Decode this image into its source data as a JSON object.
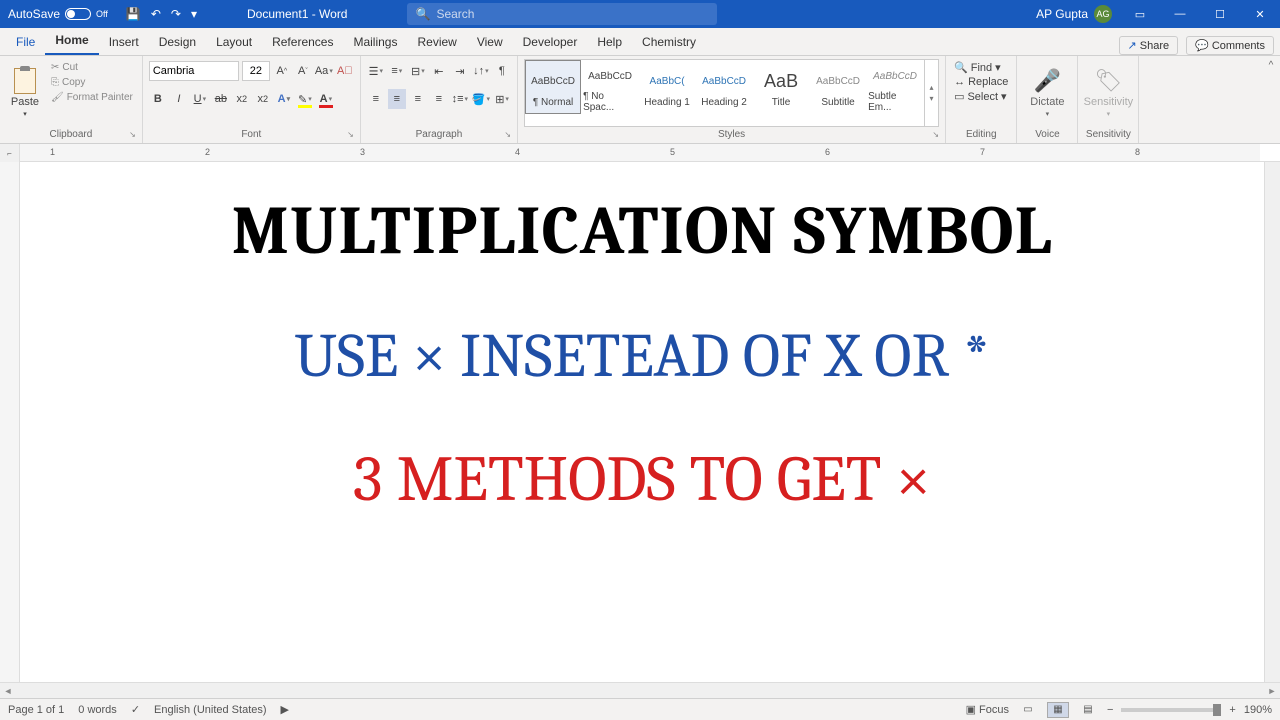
{
  "titlebar": {
    "autosave_label": "AutoSave",
    "autosave_state": "Off",
    "doc_title": "Document1 - Word",
    "search_placeholder": "Search",
    "user_name": "AP Gupta",
    "user_initials": "AG"
  },
  "tabs": {
    "items": [
      "File",
      "Home",
      "Insert",
      "Design",
      "Layout",
      "References",
      "Mailings",
      "Review",
      "View",
      "Developer",
      "Help",
      "Chemistry"
    ],
    "active": "Home",
    "share": "Share",
    "comments": "Comments"
  },
  "ribbon": {
    "clipboard": {
      "label": "Clipboard",
      "paste": "Paste",
      "cut": "Cut",
      "copy": "Copy",
      "format_painter": "Format Painter"
    },
    "font": {
      "label": "Font",
      "name": "Cambria",
      "size": "22"
    },
    "paragraph": {
      "label": "Paragraph"
    },
    "styles": {
      "label": "Styles",
      "items": [
        {
          "preview": "AaBbCcD",
          "name": "¶ Normal",
          "sel": true
        },
        {
          "preview": "AaBbCcD",
          "name": "¶ No Spac...",
          "sel": false
        },
        {
          "preview": "AaBbC(",
          "name": "Heading 1",
          "sel": false,
          "color": "#2e74b5"
        },
        {
          "preview": "AaBbCcD",
          "name": "Heading 2",
          "sel": false,
          "color": "#2e74b5"
        },
        {
          "preview": "AaB",
          "name": "Title",
          "sel": false,
          "big": true
        },
        {
          "preview": "AaBbCcD",
          "name": "Subtitle",
          "sel": false,
          "color": "#888"
        },
        {
          "preview": "AaBbCcD",
          "name": "Subtle Em...",
          "sel": false,
          "italic": true,
          "color": "#888"
        }
      ]
    },
    "editing": {
      "label": "Editing",
      "find": "Find",
      "replace": "Replace",
      "select": "Select"
    },
    "voice": {
      "label": "Voice",
      "dictate": "Dictate"
    },
    "sensitivity": {
      "label": "Sensitivity",
      "btn": "Sensitivity"
    }
  },
  "ruler": {
    "marks": [
      "1",
      "2",
      "3",
      "4",
      "5",
      "6",
      "7",
      "8"
    ]
  },
  "document": {
    "line1": "MULTIPLICATION SYMBOL",
    "line2": "USE × INSETEAD OF X OR *",
    "line3": "3 METHODS TO GET ×"
  },
  "statusbar": {
    "page": "Page 1 of 1",
    "words": "0 words",
    "lang": "English (United States)",
    "focus": "Focus",
    "zoom": "190%"
  }
}
